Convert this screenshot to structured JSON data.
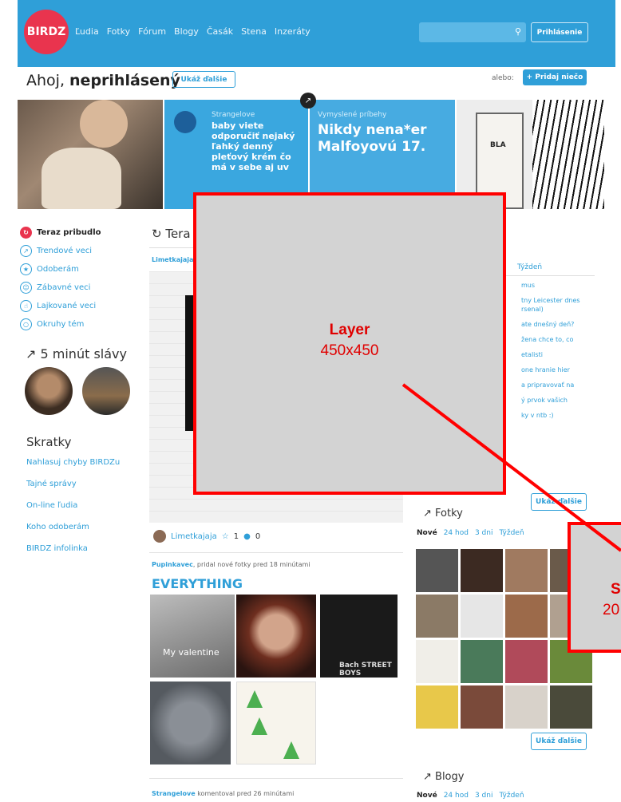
{
  "header": {
    "logo": "BIRDZ",
    "nav": [
      "Ľudia",
      "Fotky",
      "Fórum",
      "Blogy",
      "Časák",
      "Stena",
      "Inzeráty"
    ],
    "search_icon": "search-icon",
    "login_label": "Prihlásenie"
  },
  "greeting": {
    "prefix": "Ahoj,",
    "name": "neprihlásený",
    "show_more": "Ukáž ďalšie",
    "or": "alebo:",
    "add": "+ Pridaj niečo"
  },
  "hero": {
    "tile2_category": "Strangelove",
    "tile2_text": "baby viete odporučiť nejaký ľahký denný pleťový krém čo má v sebe aj uv",
    "tile3_category": "Vymyslené príbehy",
    "tile3_text": "Nikdy nena*er Malfoyovú 17.",
    "tile4_text": "BLA"
  },
  "sidebar": {
    "items": [
      {
        "label": "Teraz pribudlo",
        "icon": "refresh-icon"
      },
      {
        "label": "Trendové veci",
        "icon": "trend-icon"
      },
      {
        "label": "Odoberám",
        "icon": "star-icon"
      },
      {
        "label": "Zábavné veci",
        "icon": "smile-icon"
      },
      {
        "label": "Lajkované veci",
        "icon": "thumbs-up-icon"
      },
      {
        "label": "Okruhy tém",
        "icon": "circle-icon"
      }
    ],
    "fame_title": "5 minút slávy",
    "shortcuts_title": "Skratky",
    "shortcuts": [
      "Nahlasuj chyby BIRDZu",
      "Tajné správy",
      "On-line ľudia",
      "Koho odoberám",
      "BIRDZ infolinka"
    ]
  },
  "feed": {
    "heading": "Tera",
    "post1_author": "Limetkajaja",
    "post1_meta_author": "Limetkajaja",
    "post1_stars": "1",
    "post1_comments": "0",
    "post2_author": "Pupinkavec",
    "post2_action": ", pridal nové fotky pred 18 minútami",
    "post2_title": "EVERYTHING",
    "photo1_caption": "My valentine",
    "photo3_caption": "Bach STREET BOYS",
    "post3_author": "Strangelove",
    "post3_action": " komentoval pred 26 minútami"
  },
  "right": {
    "week_tab": "Týždeň",
    "topics": [
      "mus",
      "tny Leicester dnes rsenal)",
      "ate dnešný deň?",
      "žena chce to, co",
      "etalisti",
      "one hranie hier",
      "a pripravovať na",
      "ý prvok vašich",
      "ky v ntb :)"
    ],
    "show_more": "Ukáž ďalšie",
    "fotky_title": "Fotky",
    "fotky_tabs": [
      "Nové",
      "24 hod",
      "3 dni",
      "Týždeň"
    ],
    "fotky_more": "Ukáž ďalšie",
    "blogy_title": "Blogy",
    "blogy_tabs": [
      "Nové",
      "24 hod",
      "3 dni",
      "Týždeň"
    ]
  },
  "overlays": {
    "layer_label": "Layer",
    "layer_size": "450x450",
    "s_label": "S",
    "s_size": "20"
  }
}
